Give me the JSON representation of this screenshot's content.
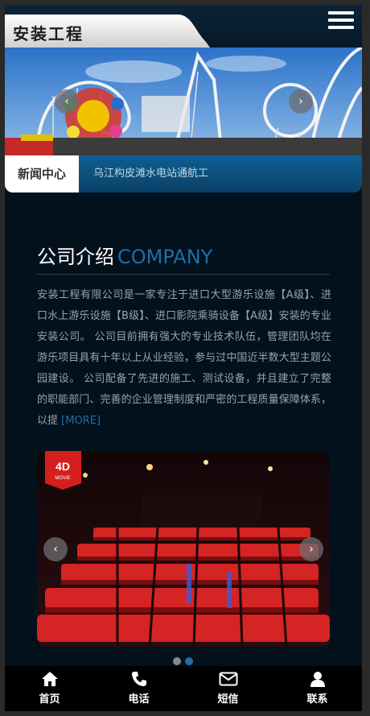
{
  "header": {
    "logo_text": "安装工程",
    "menu_icon": "hamburger-menu-icon"
  },
  "banner": {
    "prev_arrow": "‹",
    "next_arrow": "›"
  },
  "news": {
    "label": "新闻中心",
    "headline": "乌江构皮滩水电站通航工"
  },
  "company": {
    "title_cn": "公司介绍",
    "title_en": "COMPANY",
    "intro": "安装工程有限公司是一家专注于进口大型游乐设施【A级】、进口水上游乐设施【B级】、进口影院乘骑设备【A级】安装的专业安装公司。 公司目前拥有强大的专业技术队伍，管理团队均在游乐项目具有十年以上从业经验，参与过中国近半数大型主题公园建设。 公司配备了先进的施工、测试设备，并且建立了完整的职能部门、完善的企业管理制度和严密的工程质量保障体系，以提",
    "more": "[MORE]"
  },
  "carousel": {
    "prev_arrow": "‹",
    "next_arrow": "›",
    "badge_main": "4D",
    "badge_sub": "MOVIE",
    "dots": 2,
    "active_dot": 1
  },
  "footer": {
    "items": [
      {
        "label": "首页",
        "icon": "home-icon"
      },
      {
        "label": "电话",
        "icon": "phone-icon"
      },
      {
        "label": "短信",
        "icon": "mail-icon"
      },
      {
        "label": "联系",
        "icon": "user-icon"
      }
    ]
  },
  "colors": {
    "accent": "#1e6fa9",
    "background": "#03111c",
    "news_bar": "#0d5f92"
  }
}
